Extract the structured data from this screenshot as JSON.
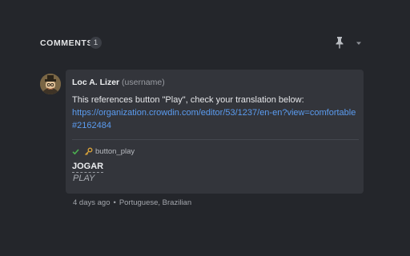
{
  "header": {
    "title": "COMMENTS",
    "count": "1",
    "pin_icon": "pin-icon",
    "menu_icon": "chevron-down-icon"
  },
  "comment": {
    "avatar_icon": "user-avatar",
    "author": "Loc A. Lizer",
    "username": "(username)",
    "text": "This references button \"Play\", check your translation below:",
    "link": "https://organization.crowdin.com/editor/53/1237/en-en?view=comfortable#2162484",
    "status_icon": "check-icon",
    "key_icon": "key-icon",
    "string_key": "button_play",
    "translation": "JOGAR",
    "source": "PLAY",
    "time": "4 days ago",
    "separator": "•",
    "language": "Portuguese, Brazilian"
  },
  "colors": {
    "background": "#24262b",
    "card": "#33353b",
    "link": "#5b9cf0",
    "check": "#4caf50",
    "key": "#d8a23a"
  }
}
